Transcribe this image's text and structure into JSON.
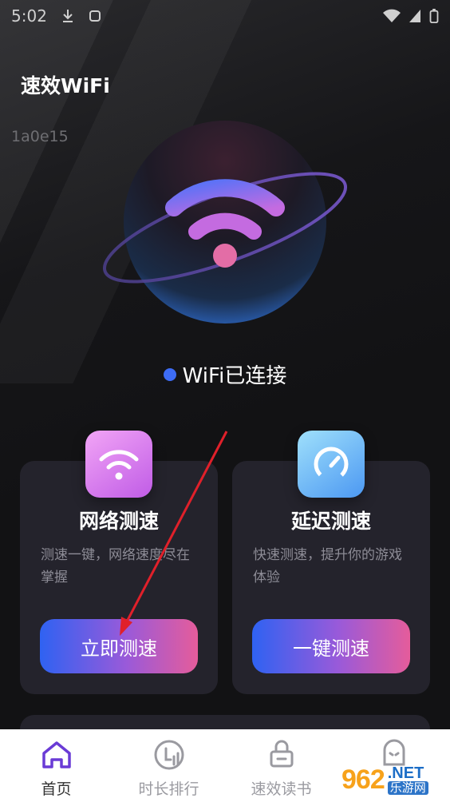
{
  "status_bar": {
    "time": "5:02"
  },
  "app": {
    "title": "速效WiFi",
    "version": "1a0e15"
  },
  "connection": {
    "status": "WiFi已连接"
  },
  "cards": [
    {
      "title": "网络测速",
      "desc": "测速一键，网络速度尽在掌握",
      "button": "立即测速",
      "icon": "wifi-icon"
    },
    {
      "title": "延迟测速",
      "desc": "快速测速，提升你的游戏体验",
      "button": "一键测速",
      "icon": "speedometer-icon"
    }
  ],
  "nav": [
    {
      "label": "首页",
      "icon": "home-icon",
      "active": true
    },
    {
      "label": "时长排行",
      "icon": "ranking-icon",
      "active": false
    },
    {
      "label": "速效读书",
      "icon": "book-icon",
      "active": false
    },
    {
      "label": "",
      "icon": "mascot-icon",
      "active": false
    }
  ],
  "watermark": {
    "main": "962",
    "net": ".NET",
    "cn": "乐游网"
  },
  "colors": {
    "background": "#121214",
    "card": "#24232c",
    "accent_blue": "#3d6cf5",
    "button_gradient_start": "#2f62f2",
    "button_gradient_end": "#e55c9b"
  }
}
